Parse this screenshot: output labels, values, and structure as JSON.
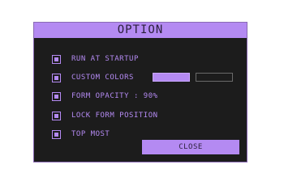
{
  "window": {
    "title": "OPTION",
    "close_label": "CLOSE"
  },
  "options": [
    {
      "label": "RUN AT STARTUP",
      "checked": true
    },
    {
      "label": "CUSTOM COLORS",
      "checked": true
    },
    {
      "label": "FORM OPACITY : 90%",
      "checked": true
    },
    {
      "label": "LOCK FORM POSITION",
      "checked": true
    },
    {
      "label": "TOP MOST",
      "checked": true
    }
  ],
  "colors": {
    "accent": "#b48af2",
    "background": "#1c1c1c",
    "custom_color_1": "#b48af2",
    "custom_color_2": "#1c1c1c"
  }
}
